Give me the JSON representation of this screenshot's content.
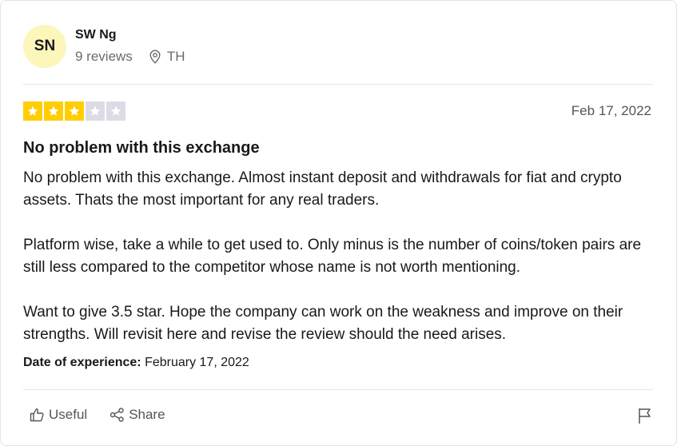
{
  "reviewer": {
    "initials": "SN",
    "name": "SW Ng",
    "reviews": "9 reviews",
    "location": "TH"
  },
  "review": {
    "rating": 3,
    "max_rating": 5,
    "date": "Feb 17, 2022",
    "title": "No problem with this exchange",
    "paragraphs": [
      "No problem with this exchange. Almost instant deposit and withdrawals for fiat and crypto assets. Thats the most important for any real traders.",
      "Platform wise, take a while to get used to. Only minus is the number of coins/token pairs are still less compared to the competitor whose name is not worth mentioning.",
      "Want to give 3.5 star. Hope the company can work on the weakness and improve on their strengths. Will revisit here and revise the review should the need arises."
    ],
    "experience_label": "Date of experience:",
    "experience_date": "February 17, 2022"
  },
  "actions": {
    "useful_label": "Useful",
    "share_label": "Share"
  },
  "colors": {
    "star_on": "#ffce00",
    "star_off": "#dcdce6",
    "avatar_bg": "#fdf6bb"
  },
  "icons": [
    "location-pin-icon",
    "star-icon",
    "thumbs-up-icon",
    "share-icon",
    "flag-icon"
  ]
}
